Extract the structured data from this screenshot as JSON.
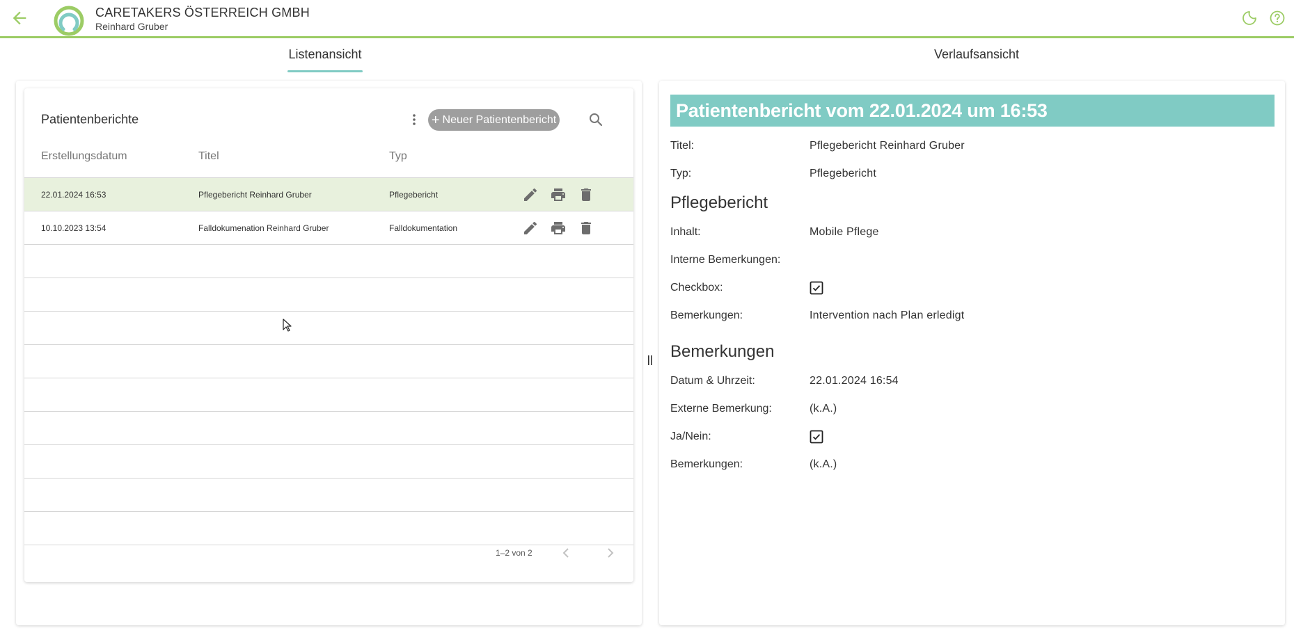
{
  "header": {
    "company": "CARETAKERS ÖSTERREICH GMBH",
    "user": "Reinhard Gruber",
    "accent_color": "#9ccc65"
  },
  "tabs": [
    {
      "label": "Listenansicht",
      "active": true
    },
    {
      "label": "Verlaufsansicht",
      "active": false
    }
  ],
  "list": {
    "title": "Patientenberichte",
    "new_button_label": "Neuer Patientenbericht",
    "columns": [
      "Erstellungsdatum",
      "Titel",
      "Typ"
    ],
    "rows": [
      {
        "date": "22.01.2024 16:53",
        "title": "Pflegebericht Reinhard Gruber",
        "type": "Pflegebericht",
        "selected": true
      },
      {
        "date": "10.10.2023 13:54",
        "title": "Falldokumenation Reinhard Gruber",
        "type": "Falldokumentation",
        "selected": false
      }
    ],
    "pagination": "1–2 von 2"
  },
  "detail": {
    "heading": "Patientenbericht vom 22.01.2024 um 16:53",
    "heading_color": "#80cbc4",
    "title_label": "Titel:",
    "title_value": "Pflegebericht Reinhard Gruber",
    "type_label": "Typ:",
    "type_value": "Pflegebericht",
    "section1": "Pflegebericht",
    "content_label": "Inhalt:",
    "content_value": "Mobile Pflege",
    "internal_label": "Interne Bemerkungen:",
    "checkbox_label": "Checkbox:",
    "remarks1_label": "Bemerkungen:",
    "remarks1_value": "Intervention nach Plan erledigt",
    "section2": "Bemerkungen",
    "datetime_label": "Datum & Uhrzeit:",
    "datetime_value": "22.01.2024 16:54",
    "external_label": "Externe Bemerkung:",
    "external_value": "(k.A.)",
    "yesno_label": "Ja/Nein:",
    "remarks2_label": "Bemerkungen:",
    "remarks2_value": "(k.A.)"
  }
}
